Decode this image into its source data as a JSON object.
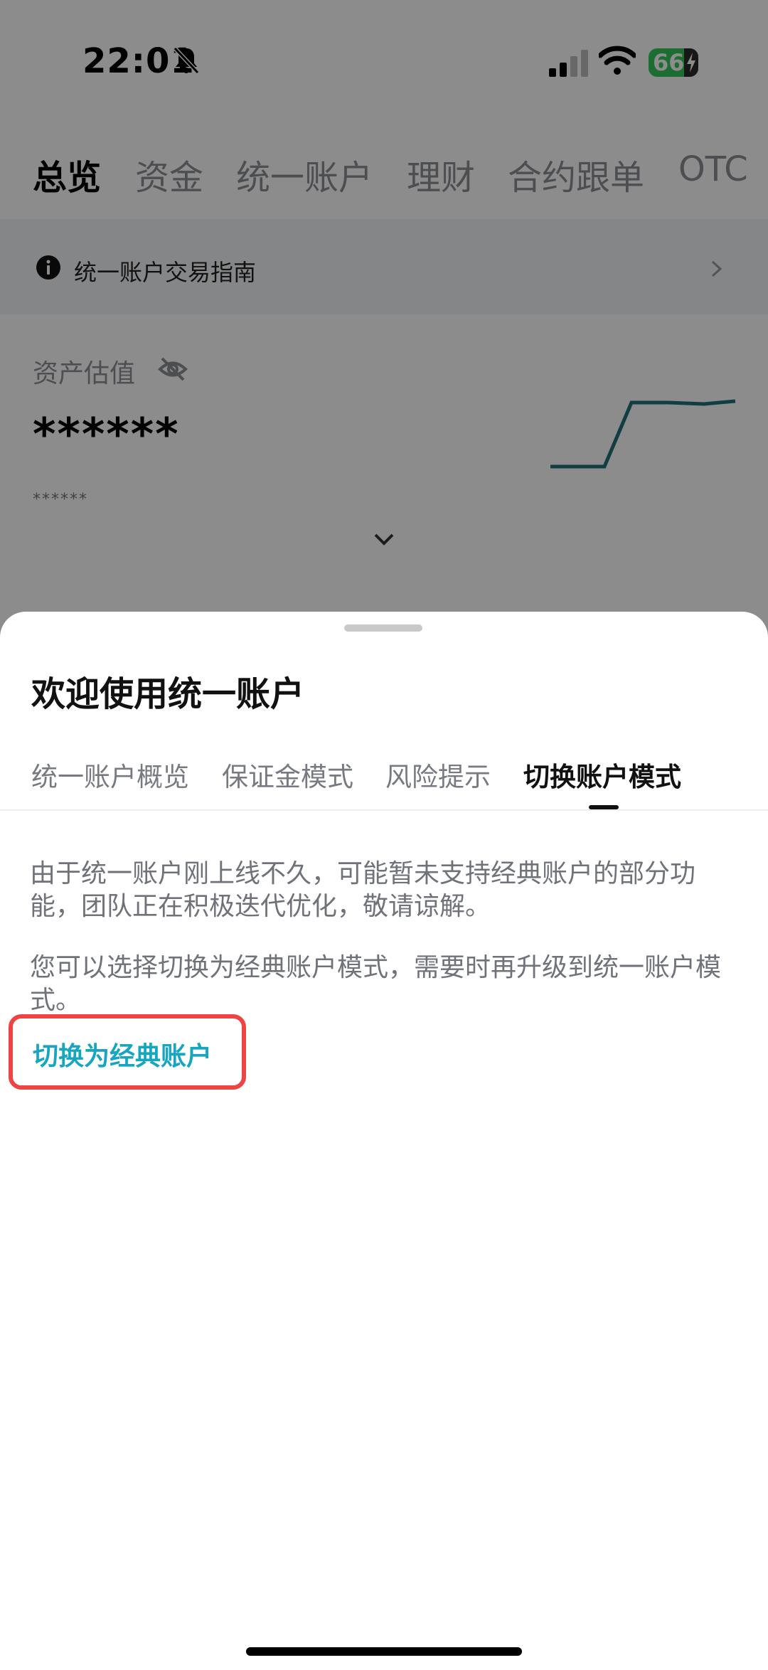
{
  "status_bar": {
    "time": "22:01",
    "battery_level": "66",
    "icons": [
      "bell-muted-icon",
      "cellular-signal-icon",
      "wifi-icon",
      "battery-charging-icon"
    ]
  },
  "top_nav": {
    "tabs": [
      {
        "label": "总览",
        "active": true
      },
      {
        "label": "资金",
        "active": false
      },
      {
        "label": "统一账户",
        "active": false
      },
      {
        "label": "理财",
        "active": false
      },
      {
        "label": "合约跟单",
        "active": false
      },
      {
        "label": "OTC",
        "active": false
      }
    ]
  },
  "guide_banner": {
    "text": "统一账户交易指南",
    "icons": [
      "info-icon",
      "chevron-right-icon"
    ]
  },
  "assets": {
    "label": "资产估值",
    "value": "******",
    "sub_value": "******",
    "icons": [
      "eye-hidden-icon",
      "chevron-down-icon"
    ]
  },
  "sheet": {
    "title": "欢迎使用统一账户",
    "tabs": [
      {
        "label": "统一账户概览",
        "active": false
      },
      {
        "label": "保证金模式",
        "active": false
      },
      {
        "label": "风险提示",
        "active": false
      },
      {
        "label": "切换账户模式",
        "active": true
      }
    ],
    "paragraph_1": "由于统一账户刚上线不久，可能暂未支持经典账户的部分功能，团队正在积极迭代优化，敬请谅解。",
    "paragraph_2": "您可以选择切换为经典账户模式，需要时再升级到统一账户模式。",
    "switch_button_label": "切换为经典账户"
  },
  "colors": {
    "accent": "#16a6c0",
    "highlight_border": "#ef4444",
    "battery": "#34c759",
    "sparkline": "#1f6f7a"
  }
}
